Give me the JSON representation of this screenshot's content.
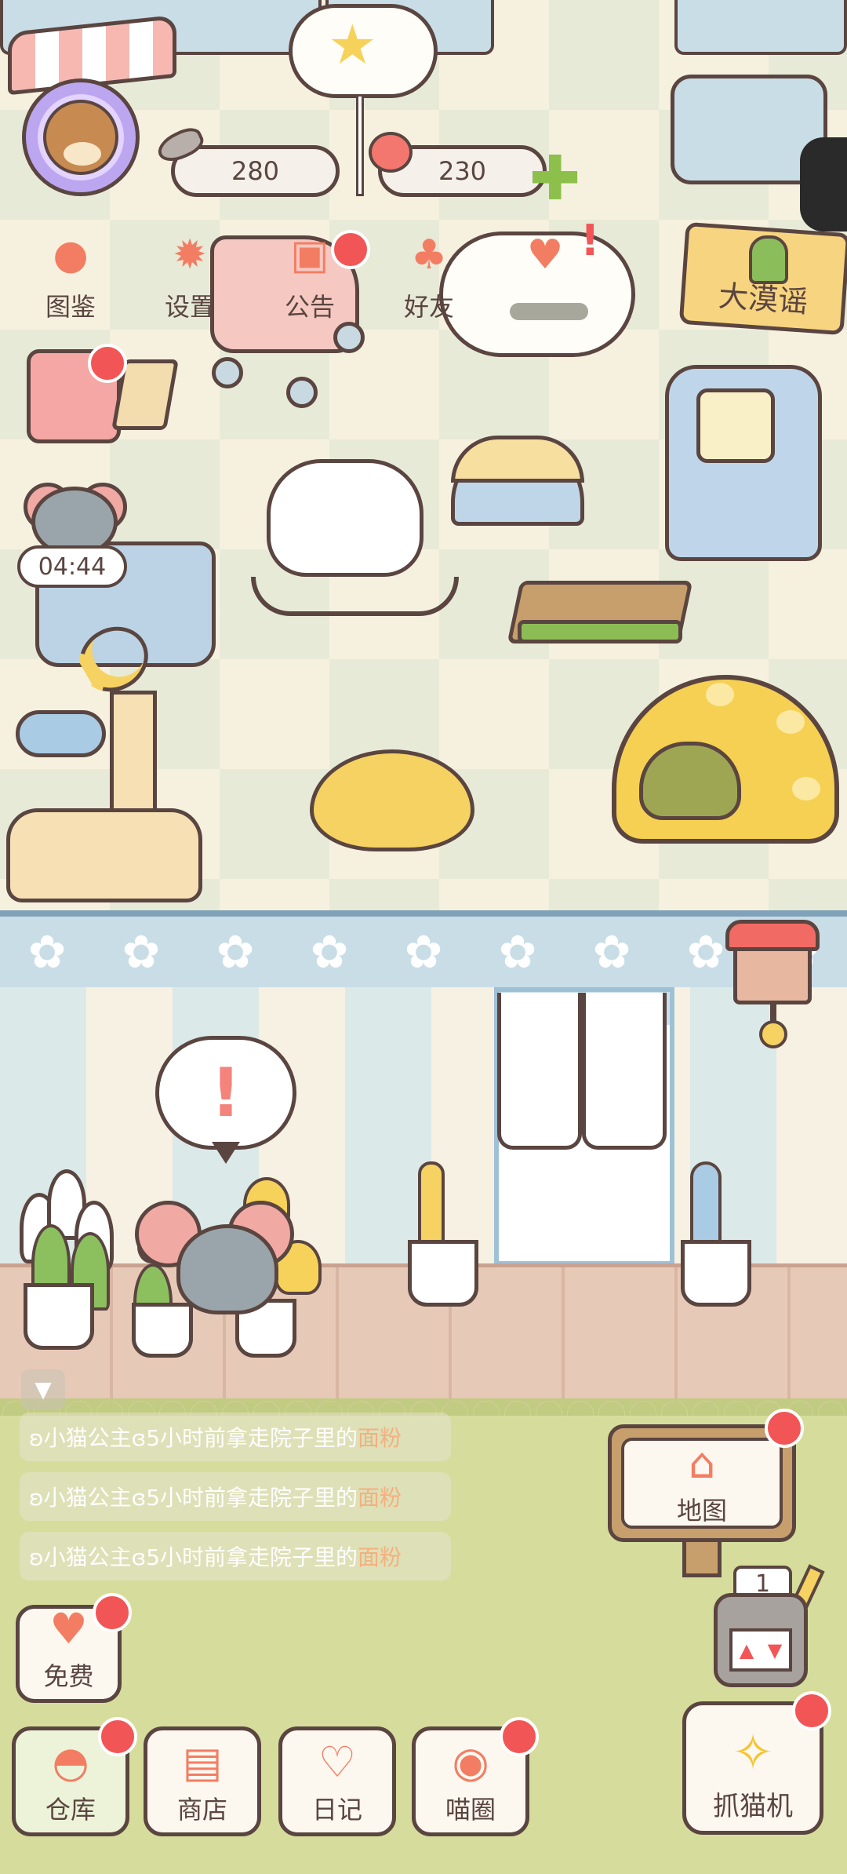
{
  "hud": {
    "fish_currency": "280",
    "cherry_currency": "230",
    "add_symbol": "✚"
  },
  "menu": {
    "items": [
      {
        "label": "图鉴",
        "icon": "cat-face-icon"
      },
      {
        "label": "设置",
        "icon": "gear-icon"
      },
      {
        "label": "公告",
        "icon": "gift-icon"
      },
      {
        "label": "好友",
        "icon": "friends-icon"
      }
    ]
  },
  "event": {
    "label": "大漠谣",
    "icon": "cactus-icon"
  },
  "timer": {
    "value": "04:44"
  },
  "room": {
    "alert_symbol": "!"
  },
  "activity_log": {
    "collapse_symbol": "▼",
    "entries": [
      {
        "prefix": "ʚ小猫公主ɞ5小时前拿走院子里的",
        "item": "面粉"
      },
      {
        "prefix": "ʚ小猫公主ɞ5小时前拿走院子里的",
        "item": "面粉"
      },
      {
        "prefix": "ʚ小猫公主ɞ5小时前拿走院子里的",
        "item": "面粉"
      }
    ]
  },
  "map": {
    "label": "地图",
    "icon": "house-icon"
  },
  "free": {
    "label": "免费",
    "icon": "heart-icon"
  },
  "slot": {
    "count": "1"
  },
  "bottom_nav": {
    "items": [
      {
        "label": "仓库",
        "icon": "storage-icon"
      },
      {
        "label": "商店",
        "icon": "shop-icon"
      },
      {
        "label": "日记",
        "icon": "diary-icon"
      },
      {
        "label": "喵圈",
        "icon": "planet-cat-icon"
      }
    ]
  },
  "claw": {
    "label": "抓猫机",
    "icon": "claw-icon"
  },
  "colors": {
    "ink": "#5a4540",
    "notification_red": "#f25555",
    "accent_coral": "#f37d62",
    "grass": "#d6dd9c",
    "wall_blue": "#c9dde6"
  }
}
